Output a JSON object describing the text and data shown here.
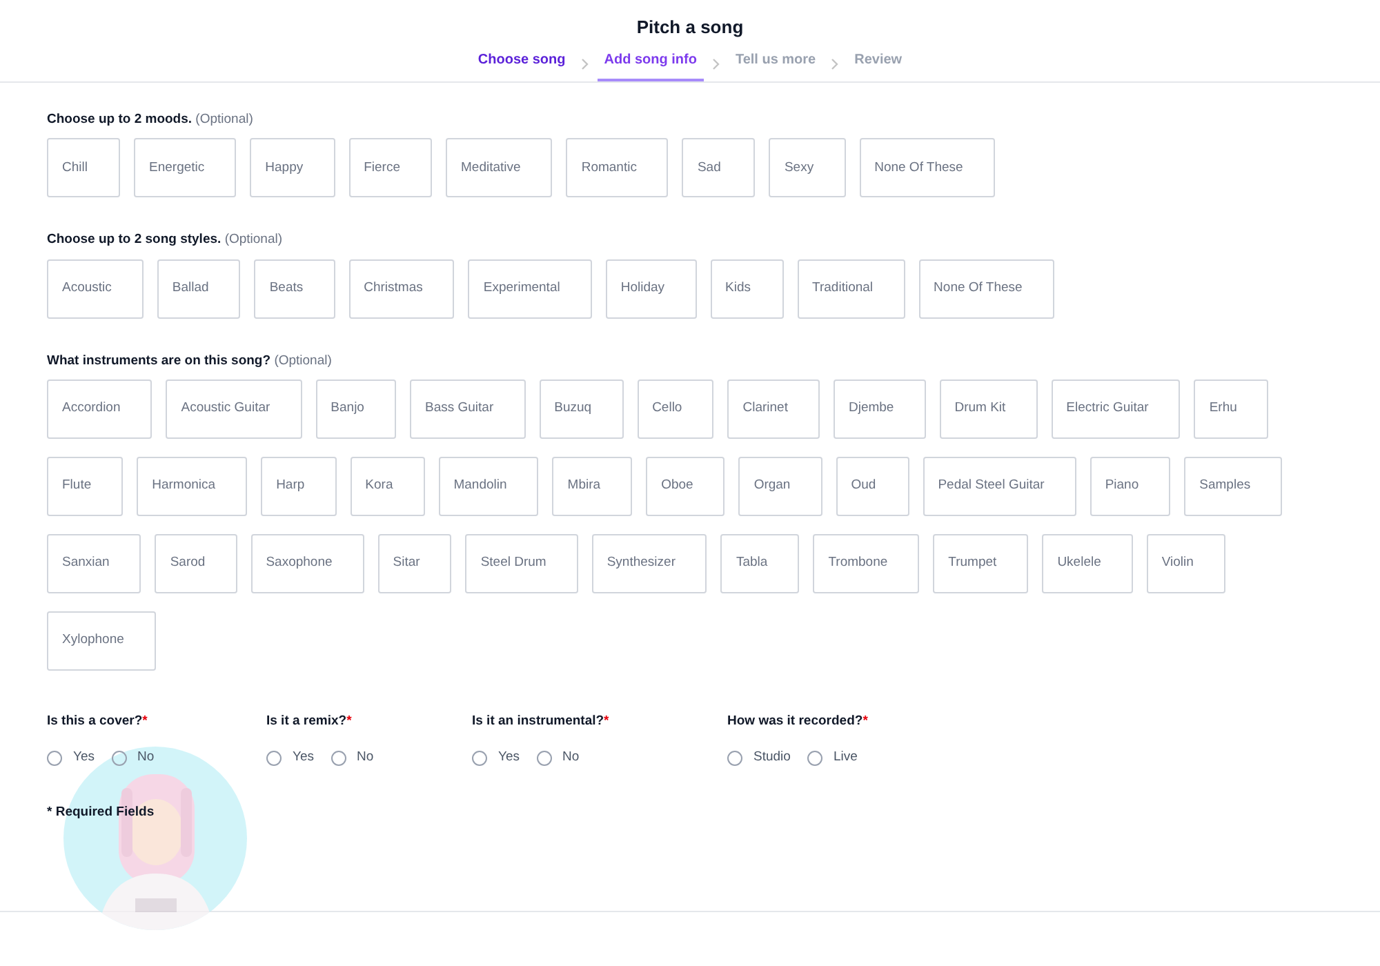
{
  "title": "Pitch a song",
  "steps": [
    {
      "label": "Choose song",
      "completed": true,
      "selected": false
    },
    {
      "label": "Add song info",
      "completed": false,
      "selected": true
    },
    {
      "label": "Tell us more",
      "completed": false,
      "selected": false
    },
    {
      "label": "Review",
      "completed": false,
      "selected": false
    }
  ],
  "sections": [
    {
      "label": "Choose up to 2 moods.",
      "note": "(Optional)",
      "options": [
        {
          "label": "Chill",
          "selected": false
        },
        {
          "label": "Energetic",
          "selected": false
        },
        {
          "label": "Happy",
          "selected": false
        },
        {
          "label": "Fierce",
          "selected": false
        },
        {
          "label": "Meditative",
          "selected": false
        },
        {
          "label": "Romantic",
          "selected": false
        },
        {
          "label": "Sad",
          "selected": false
        },
        {
          "label": "Sexy",
          "selected": false
        },
        {
          "label": "None Of These",
          "selected": false
        }
      ]
    },
    {
      "label": "Choose up to 2 song styles.",
      "note": "(Optional)",
      "options": [
        {
          "label": "Acoustic",
          "selected": false
        },
        {
          "label": "Ballad",
          "selected": false
        },
        {
          "label": "Beats",
          "selected": false
        },
        {
          "label": "Christmas",
          "selected": false
        },
        {
          "label": "Experimental",
          "selected": false
        },
        {
          "label": "Holiday",
          "selected": false
        },
        {
          "label": "Kids",
          "selected": false
        },
        {
          "label": "Traditional",
          "selected": false
        },
        {
          "label": "None Of These",
          "selected": false
        }
      ]
    },
    {
      "label": "What instruments are on this song?",
      "note": "(Optional)",
      "options": [
        {
          "label": "Accordion",
          "selected": false
        },
        {
          "label": "Acoustic Guitar",
          "selected": false
        },
        {
          "label": "Banjo",
          "selected": false
        },
        {
          "label": "Bass Guitar",
          "selected": false
        },
        {
          "label": "Buzuq",
          "selected": false
        },
        {
          "label": "Cello",
          "selected": false
        },
        {
          "label": "Clarinet",
          "selected": false
        },
        {
          "label": "Djembe",
          "selected": false
        },
        {
          "label": "Drum Kit",
          "selected": false
        },
        {
          "label": "Electric Guitar",
          "selected": false
        },
        {
          "label": "Erhu",
          "selected": false
        },
        {
          "label": "Flute",
          "selected": false
        },
        {
          "label": "Harmonica",
          "selected": false
        },
        {
          "label": "Harp",
          "selected": false
        },
        {
          "label": "Kora",
          "selected": false
        },
        {
          "label": "Mandolin",
          "selected": false
        },
        {
          "label": "Mbira",
          "selected": false
        },
        {
          "label": "Oboe",
          "selected": false
        },
        {
          "label": "Organ",
          "selected": false
        },
        {
          "label": "Oud",
          "selected": false
        },
        {
          "label": "Pedal Steel Guitar",
          "selected": false
        },
        {
          "label": "Piano",
          "selected": false
        },
        {
          "label": "Samples",
          "selected": false
        },
        {
          "label": "Sanxian",
          "selected": false
        },
        {
          "label": "Sarod",
          "selected": false
        },
        {
          "label": "Saxophone",
          "selected": false
        },
        {
          "label": "Sitar",
          "selected": false
        },
        {
          "label": "Steel Drum",
          "selected": false
        },
        {
          "label": "Synthesizer",
          "selected": false
        },
        {
          "label": "Tabla",
          "selected": false
        },
        {
          "label": "Trombone",
          "selected": false
        },
        {
          "label": "Trumpet",
          "selected": false
        },
        {
          "label": "Ukelele",
          "selected": false
        },
        {
          "label": "Violin",
          "selected": false
        },
        {
          "label": "Xylophone",
          "selected": false
        }
      ]
    }
  ],
  "questions": [
    {
      "label": "Is this a cover?",
      "required": true,
      "options": [
        {
          "label": "Yes",
          "selected": false
        },
        {
          "label": "No",
          "selected": false
        }
      ]
    },
    {
      "label": "Is it a remix?",
      "required": true,
      "options": [
        {
          "label": "Yes",
          "selected": false
        },
        {
          "label": "No",
          "selected": false
        }
      ]
    },
    {
      "label": "Is it an instrumental?",
      "required": true,
      "options": [
        {
          "label": "Yes",
          "selected": false
        },
        {
          "label": "No",
          "selected": false
        }
      ]
    },
    {
      "label": "How was it recorded?",
      "required": true,
      "options": [
        {
          "label": "Studio",
          "selected": false
        },
        {
          "label": "Live",
          "selected": false
        }
      ]
    }
  ],
  "required_asterisk": "*",
  "footnote": "* Required Fields"
}
